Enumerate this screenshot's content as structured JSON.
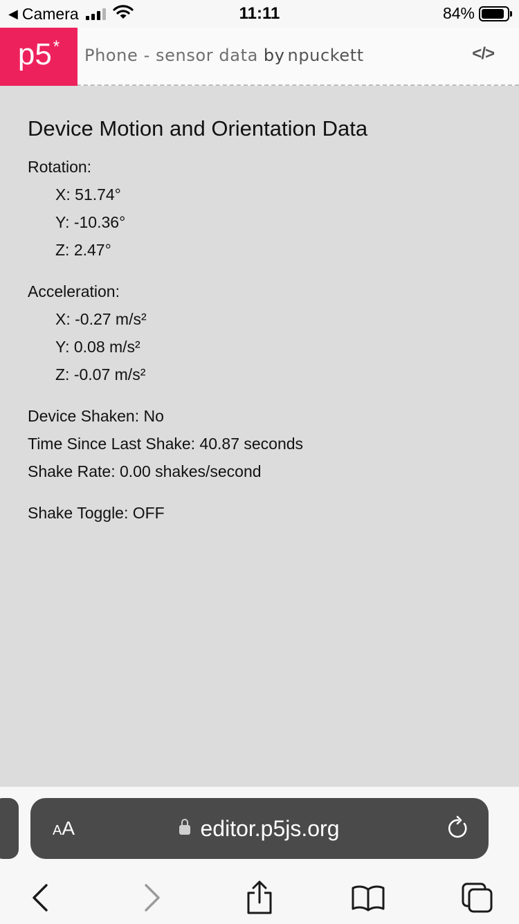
{
  "status_bar": {
    "back_label": "Camera",
    "time": "11:11",
    "battery": "84%"
  },
  "header": {
    "logo": "p5",
    "logo_mark": "*",
    "sketch_name": "Phone - sensor data",
    "by": "by",
    "author": "npuckett",
    "code_toggle": "</>"
  },
  "content": {
    "title": "Device Motion and Orientation Data",
    "rotation": {
      "label": "Rotation:",
      "x": "X: 51.74°",
      "y": "Y: -10.36°",
      "z": "Z: 2.47°"
    },
    "acceleration": {
      "label": "Acceleration:",
      "x": "X: -0.27 m/s²",
      "y": "Y: 0.08 m/s²",
      "z": "Z: -0.07 m/s²"
    },
    "device_shaken": "Device Shaken: No",
    "time_since_shake": "Time Since Last Shake: 40.87 seconds",
    "shake_rate": "Shake Rate: 0.00 shakes/second",
    "shake_toggle": "Shake Toggle: OFF"
  },
  "safari": {
    "aa_small": "A",
    "aa_large": "A",
    "url": "editor.p5js.org"
  },
  "colors": {
    "p5_pink": "#ed225d",
    "canvas_bg": "#dcdcdc",
    "pill_bg": "#4a4a4a"
  }
}
